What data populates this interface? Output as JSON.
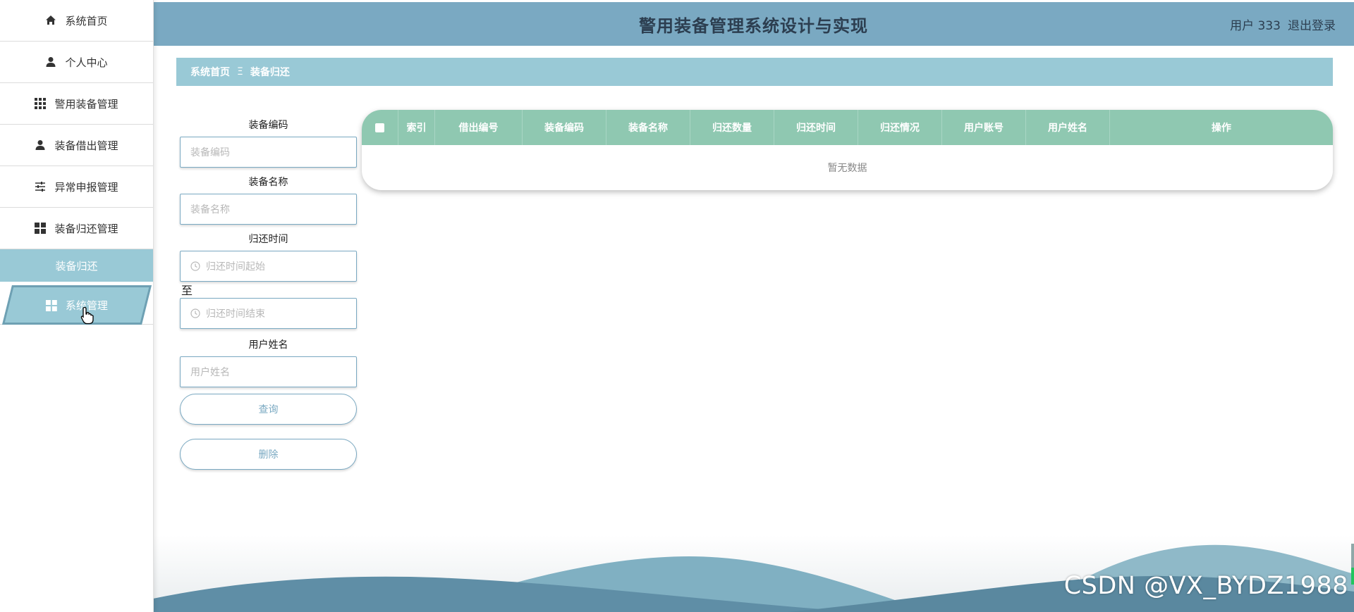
{
  "header": {
    "title": "警用装备管理系统设计与实现",
    "user_label": "用户 333",
    "logout_label": "退出登录"
  },
  "sidebar": {
    "items": [
      {
        "label": "系统首页",
        "icon": "home-icon"
      },
      {
        "label": "个人中心",
        "icon": "user-icon"
      },
      {
        "label": "警用装备管理",
        "icon": "grid-icon"
      },
      {
        "label": "装备借出管理",
        "icon": "user-icon"
      },
      {
        "label": "异常申报管理",
        "icon": "sliders-icon"
      },
      {
        "label": "装备归还管理",
        "icon": "apps-icon"
      }
    ],
    "sub_item": "装备归还",
    "active_item": {
      "label": "系统管理",
      "icon": "apps-icon"
    }
  },
  "breadcrumb": {
    "home": "系统首页",
    "separator": "Ξ",
    "current": "装备归还"
  },
  "search": {
    "code_label": "装备编码",
    "code_placeholder": "装备编码",
    "name_label": "装备名称",
    "name_placeholder": "装备名称",
    "time_label": "归还时间",
    "time_start_placeholder": "归还时间起始",
    "to_label": "至",
    "time_end_placeholder": "归还时间结束",
    "username_label": "用户姓名",
    "username_placeholder": "用户姓名",
    "query_button": "查询",
    "delete_button": "删除"
  },
  "table": {
    "columns": [
      "索引",
      "借出编号",
      "装备编码",
      "装备名称",
      "归还数量",
      "归还时间",
      "归还情况",
      "用户账号",
      "用户姓名",
      "操作"
    ],
    "empty_text": "暂无数据"
  },
  "watermark": "CSDN @VX_BYDZ1988",
  "colors": {
    "header": "#7aa9c2",
    "accent": "#99c9d6",
    "table_header": "#8fc8b1"
  }
}
